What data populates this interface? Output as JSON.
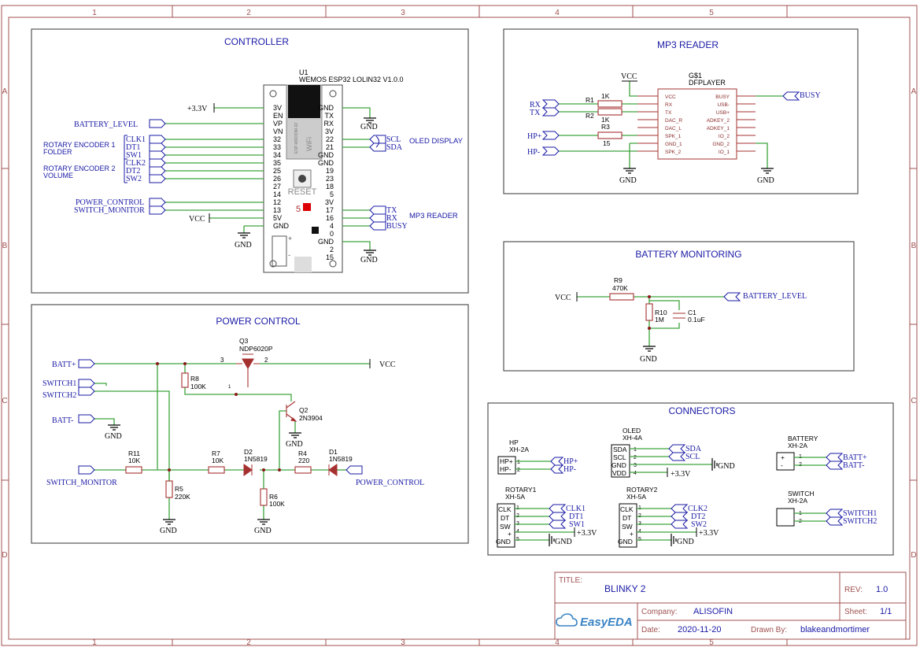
{
  "sheet": {
    "col_labels": [
      "1",
      "2",
      "3",
      "4",
      "5"
    ],
    "row_labels": [
      "A",
      "B",
      "C",
      "D"
    ]
  },
  "controller": {
    "title": "CONTROLLER",
    "ref": "U1",
    "part": "WEMOS ESP32 LOLIN32 V1.0.0",
    "module_text": "ESP-WROOM-32",
    "wifi_text": "WiFi",
    "reset_label": "RESET",
    "led_label": "5",
    "left_pins": [
      "3V",
      "EN",
      "VP",
      "VN",
      "32",
      "33",
      "34",
      "35",
      "25",
      "26",
      "27",
      "14",
      "12",
      "13",
      "5V",
      "GND"
    ],
    "right_pins": [
      "GND",
      "TX",
      "RX",
      "3V",
      "22",
      "21",
      "GND",
      "GND",
      "19",
      "23",
      "18",
      "5",
      "3V",
      "17",
      "16",
      "4",
      "0",
      "GND",
      "2",
      "15"
    ],
    "nets": {
      "v33": "+3.3V",
      "battery_level": "BATTERY_LEVEL",
      "rot1_line1": "ROTARY ENCODER 1",
      "rot1_line2": "FOLDER",
      "rot2_line1": "ROTARY ENCODER 2",
      "rot2_line2": "VOLUME",
      "clk1": "CLK1",
      "dt1": "DT1",
      "sw1": "SW1",
      "clk2": "CLK2",
      "dt2": "DT2",
      "sw2": "SW2",
      "power_control": "POWER_CONTROL",
      "switch_monitor": "SWITCH_MONITOR",
      "vcc": "VCC",
      "gnd": "GND",
      "scl": "SCL",
      "sda": "SDA",
      "oled": "OLED DISPLAY",
      "tx": "TX",
      "rx": "RX",
      "busy": "BUSY",
      "mp3": "MP3 READER"
    }
  },
  "mp3": {
    "title": "MP3 READER",
    "ref": "G$1",
    "part": "DFPLAYER",
    "left_pins": [
      "VCC",
      "RX",
      "TX",
      "DAC_R",
      "DAC_L",
      "SPK_1",
      "GND_1",
      "SPK_2"
    ],
    "right_pins": [
      "BUSY",
      "USB-",
      "USB+",
      "ADKEY_2",
      "ADKEY_1",
      "IO_2",
      "GND_2",
      "IO_1"
    ],
    "vcc": "VCC",
    "gnd": "GND",
    "rx": "RX",
    "tx": "TX",
    "hp_plus": "HP+",
    "hp_minus": "HP-",
    "busy": "BUSY",
    "r1": "R1",
    "r1v": "1K",
    "r2": "R2",
    "r2v": "1K",
    "r3": "R3",
    "r3v": "15"
  },
  "battery": {
    "title": "BATTERY MONITORING",
    "vcc": "VCC",
    "r9": "R9",
    "r9v": "470K",
    "r10": "R10",
    "r10v": "1M",
    "c1": "C1",
    "c1v": "0.1uF",
    "net": "BATTERY_LEVEL",
    "gnd": "GND"
  },
  "power": {
    "title": "POWER CONTROL",
    "batt_plus": "BATT+",
    "switch1": "SWITCH1",
    "switch2": "SWITCH2",
    "batt_minus": "BATT-",
    "switch_monitor": "SWITCH_MONITOR",
    "power_control": "POWER_CONTROL",
    "vcc": "VCC",
    "gnd": "GND",
    "q3": "Q3",
    "q3v": "NDP6020P",
    "q2": "Q2",
    "q2v": "2N3904",
    "r8": "R8",
    "r8v": "100K",
    "r11": "R11",
    "r11v": "10K",
    "r5": "R5",
    "r5v": "220K",
    "r7": "R7",
    "r7v": "10K",
    "r6": "R6",
    "r6v": "100K",
    "r4": "R4",
    "r4v": "220",
    "d2": "D2",
    "d2v": "1N5819",
    "d1": "D1",
    "d1v": "1N5819",
    "pin3": "3",
    "pin2": "2",
    "pin1": "1"
  },
  "connectors": {
    "title": "CONNECTORS",
    "hp": {
      "name": "HP",
      "type": "XH-2A",
      "pins": [
        "HP+",
        "HP-"
      ],
      "nets": [
        "HP+",
        "HP-"
      ]
    },
    "oled": {
      "name": "OLED",
      "type": "XH-4A",
      "pins": [
        "SDA",
        "SCL",
        "GND",
        "VDD"
      ],
      "nets": [
        "SDA",
        "SCL",
        "GND",
        "+3.3V"
      ]
    },
    "battery": {
      "name": "BATTERY",
      "type": "XH-2A",
      "pins": [
        "+",
        "-"
      ],
      "nets": [
        "BATT+",
        "BATT-"
      ]
    },
    "rotary1": {
      "name": "ROTARY1",
      "type": "XH-5A",
      "pins": [
        "CLK",
        "DT",
        "SW",
        "+",
        "GND"
      ],
      "nets": [
        "CLK1",
        "DT1",
        "SW1",
        "+3.3V",
        "GND"
      ]
    },
    "rotary2": {
      "name": "ROTARY2",
      "type": "XH-5A",
      "pins": [
        "CLK",
        "DT",
        "SW",
        "+",
        "GND"
      ],
      "nets": [
        "CLK2",
        "DT2",
        "SW2",
        "+3.3V",
        "GND"
      ]
    },
    "switch": {
      "name": "SWITCH",
      "type": "XH-2A",
      "pins": [
        "",
        ""
      ],
      "nets": [
        "SWITCH1",
        "SWITCH2"
      ]
    },
    "pin_numbers": [
      "1",
      "2",
      "3",
      "4",
      "5"
    ]
  },
  "title_block": {
    "title_label": "TITLE:",
    "title": "BLINKY 2",
    "rev_label": "REV:",
    "rev": "1.0",
    "company_label": "Company:",
    "company": "ALISOFIN",
    "sheet_label": "Sheet:",
    "sheet": "1/1",
    "date_label": "Date:",
    "date": "2020-11-20",
    "drawn_label": "Drawn By:",
    "drawn": "blakeandmortimer",
    "logo_text": "EasyEDA"
  }
}
